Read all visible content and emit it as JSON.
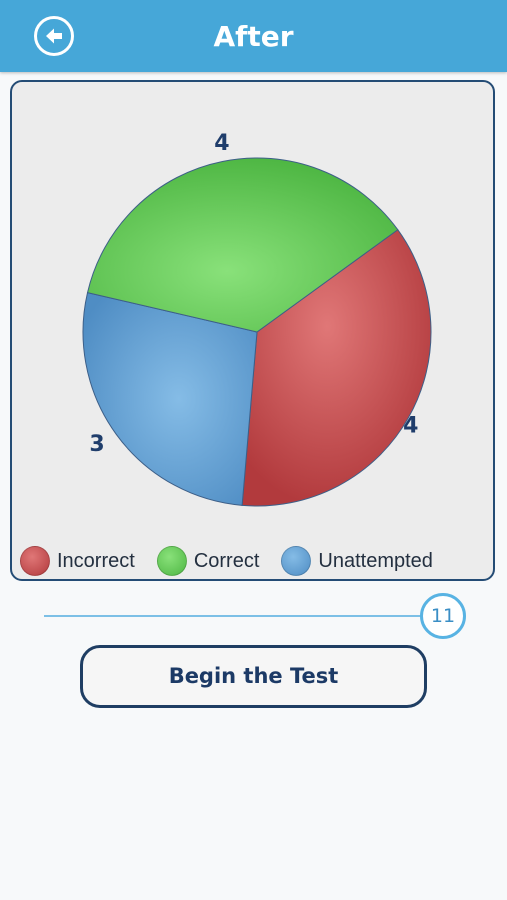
{
  "header": {
    "title": "After",
    "back_icon": "back-arrow-icon"
  },
  "chart_data": {
    "type": "pie",
    "categories": [
      "Incorrect",
      "Correct",
      "Unattempted"
    ],
    "values": [
      4,
      4,
      3
    ],
    "colors": [
      "#c64a4a",
      "#6ccf5f",
      "#67a5d6"
    ],
    "legend_position": "bottom"
  },
  "slider": {
    "value": "11"
  },
  "actions": {
    "begin_label": "Begin the Test"
  }
}
